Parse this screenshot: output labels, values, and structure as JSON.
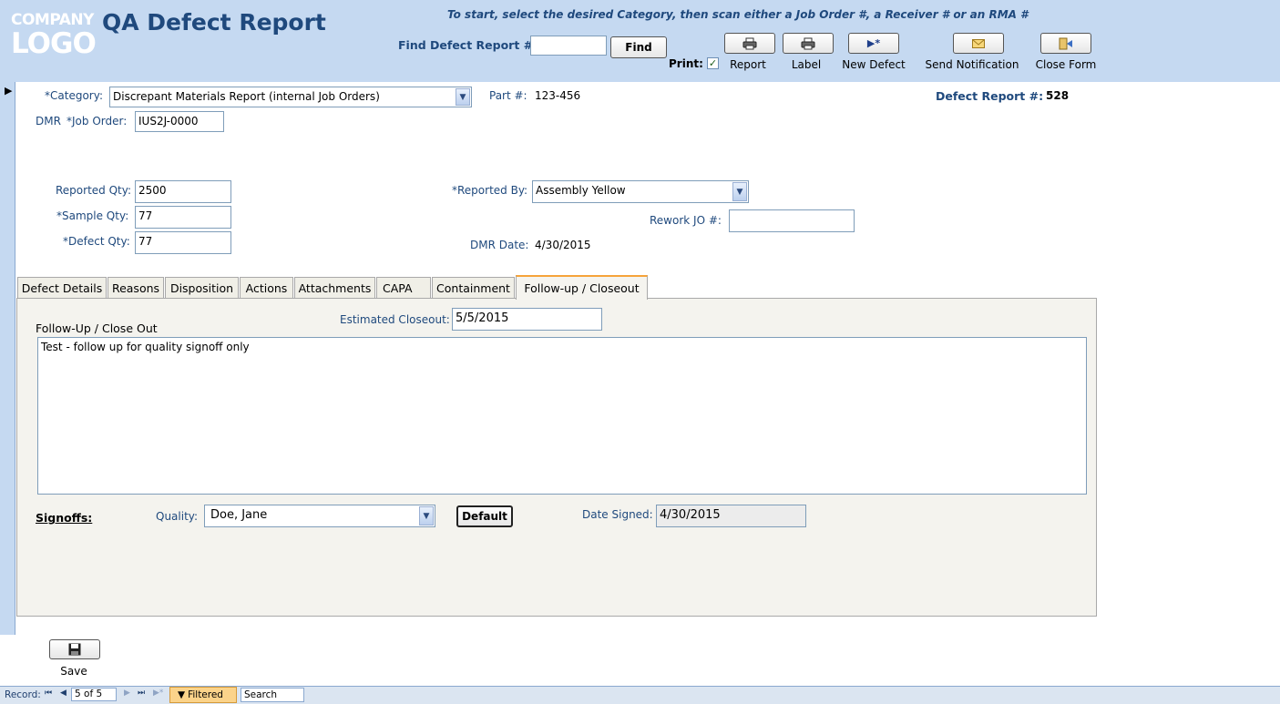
{
  "header": {
    "logo_line1": "COMPANY",
    "logo_line2": "LOGO",
    "title": "QA Defect Report",
    "instruction": "To start, select the desired Category, then scan either a Job Order #, a Receiver # or an RMA #",
    "find_label": "Find Defect Report #:",
    "find_value": "",
    "find_button": "Find",
    "print_label": "Print:",
    "print_checked": true,
    "toolbar": [
      {
        "label": "Report",
        "icon": "printer-icon"
      },
      {
        "label": "Label",
        "icon": "printer-icon"
      },
      {
        "label": "New Defect",
        "icon": "new-record-icon"
      },
      {
        "label": "Send Notification",
        "icon": "envelope-icon"
      },
      {
        "label": "Close Form",
        "icon": "close-form-icon"
      }
    ]
  },
  "form": {
    "category_label": "*Category:",
    "category_value": "Discrepant Materials Report (internal Job Orders)",
    "part_label": "Part #:",
    "part_value": "123-456",
    "defect_report_label": "Defect Report #:",
    "defect_report_value": "528",
    "dmr_prefix": "DMR",
    "job_order_label": "*Job Order:",
    "job_order_value": "IUS2J-0000",
    "reported_qty_label": "Reported Qty:",
    "reported_qty_value": "2500",
    "sample_qty_label": "*Sample Qty:",
    "sample_qty_value": "77",
    "defect_qty_label": "*Defect Qty:",
    "defect_qty_value": "77",
    "reported_by_label": "*Reported By:",
    "reported_by_value": "Assembly Yellow",
    "rework_label": "Rework JO #:",
    "rework_value": "",
    "dmr_date_label": "DMR Date:",
    "dmr_date_value": "4/30/2015"
  },
  "tabs": [
    {
      "label": "Defect Details",
      "active": false
    },
    {
      "label": "Reasons",
      "active": false
    },
    {
      "label": "Disposition",
      "active": false
    },
    {
      "label": "Actions",
      "active": false
    },
    {
      "label": "Attachments",
      "active": false
    },
    {
      "label": "CAPA",
      "active": false
    },
    {
      "label": "Containment",
      "active": false
    },
    {
      "label": "Follow-up / Closeout",
      "active": true
    }
  ],
  "followup": {
    "section_label": "Follow-Up / Close Out",
    "est_closeout_label": "Estimated Closeout:",
    "est_closeout_value": "5/5/2015",
    "notes": "Test - follow up for quality signoff only",
    "signoffs_label": "Signoffs:",
    "quality_label": "Quality:",
    "quality_value": "Doe, Jane",
    "default_button": "Default",
    "date_signed_label": "Date Signed:",
    "date_signed_value": "4/30/2015"
  },
  "save_label": "Save",
  "status": {
    "record_label": "Record:",
    "record_value": "5 of 5",
    "filter_label": "Filtered",
    "search_label": "Search"
  }
}
